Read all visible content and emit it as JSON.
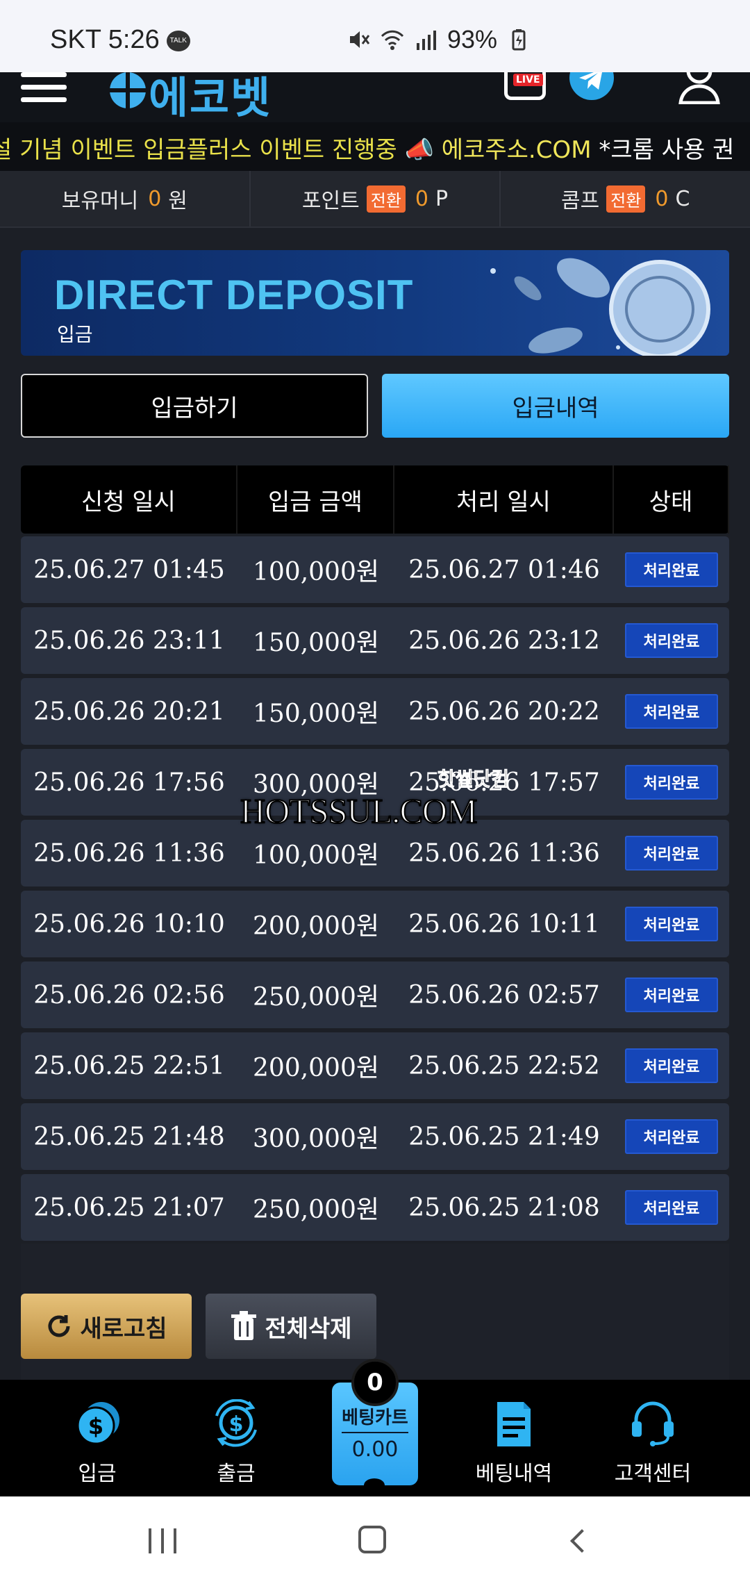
{
  "status_bar": {
    "carrier_time": "SKT 5:26",
    "talk_badge": "TALK",
    "battery": "93%"
  },
  "header": {
    "logo_text": "에코벳",
    "live_label": "LIVE"
  },
  "marquee": {
    "part1": "설 기념 이벤트 입금플러스 이벤트 진행중 ",
    "part2": "에코주소.COM",
    "part3": " *크롬 사용 권"
  },
  "balance": {
    "money_label": "보유머니",
    "money_value": "0",
    "money_unit": "원",
    "point_label": "포인트",
    "point_tag": "전환",
    "point_value": "0",
    "point_unit": "P",
    "comp_label": "콤프",
    "comp_tag": "전환",
    "comp_value": "0",
    "comp_unit": "C"
  },
  "banner": {
    "title": "DIRECT DEPOSIT",
    "subtitle": "입금"
  },
  "tabs": {
    "deposit": "입금하기",
    "history": "입금내역"
  },
  "table": {
    "headers": [
      "신청 일시",
      "입금 금액",
      "처리 일시",
      "상태"
    ],
    "rows": [
      {
        "requested": "25.06.27 01:45",
        "amount": "100,000원",
        "processed": "25.06.27 01:46",
        "status": "처리완료"
      },
      {
        "requested": "25.06.26 23:11",
        "amount": "150,000원",
        "processed": "25.06.26 23:12",
        "status": "처리완료"
      },
      {
        "requested": "25.06.26 20:21",
        "amount": "150,000원",
        "processed": "25.06.26 20:22",
        "status": "처리완료"
      },
      {
        "requested": "25.06.26 17:56",
        "amount": "300,000원",
        "processed": "25.06.26 17:57",
        "status": "처리완료"
      },
      {
        "requested": "25.06.26 11:36",
        "amount": "100,000원",
        "processed": "25.06.26 11:36",
        "status": "처리완료"
      },
      {
        "requested": "25.06.26 10:10",
        "amount": "200,000원",
        "processed": "25.06.26 10:11",
        "status": "처리완료"
      },
      {
        "requested": "25.06.26 02:56",
        "amount": "250,000원",
        "processed": "25.06.26 02:57",
        "status": "처리완료"
      },
      {
        "requested": "25.06.25 22:51",
        "amount": "200,000원",
        "processed": "25.06.25 22:52",
        "status": "처리완료"
      },
      {
        "requested": "25.06.25 21:48",
        "amount": "300,000원",
        "processed": "25.06.25 21:49",
        "status": "처리완료"
      },
      {
        "requested": "25.06.25 21:07",
        "amount": "250,000원",
        "processed": "25.06.25 21:08",
        "status": "처리완료"
      }
    ]
  },
  "watermark": {
    "text": "HOTSSUL.COM",
    "small": "핫썰닷컴"
  },
  "actions": {
    "refresh": "새로고침",
    "delete_all": "전체삭제"
  },
  "bottom_nav": {
    "deposit": "입금",
    "withdraw": "출금",
    "cart_label": "베팅카트",
    "cart_value": "0.00",
    "cart_count": "0",
    "history": "베팅내역",
    "support": "고객센터"
  },
  "colors": {
    "accent_blue": "#2aa7f5",
    "status_badge": "#1546b8",
    "orange": "#f09a2c",
    "gold": "#d4a85a"
  }
}
